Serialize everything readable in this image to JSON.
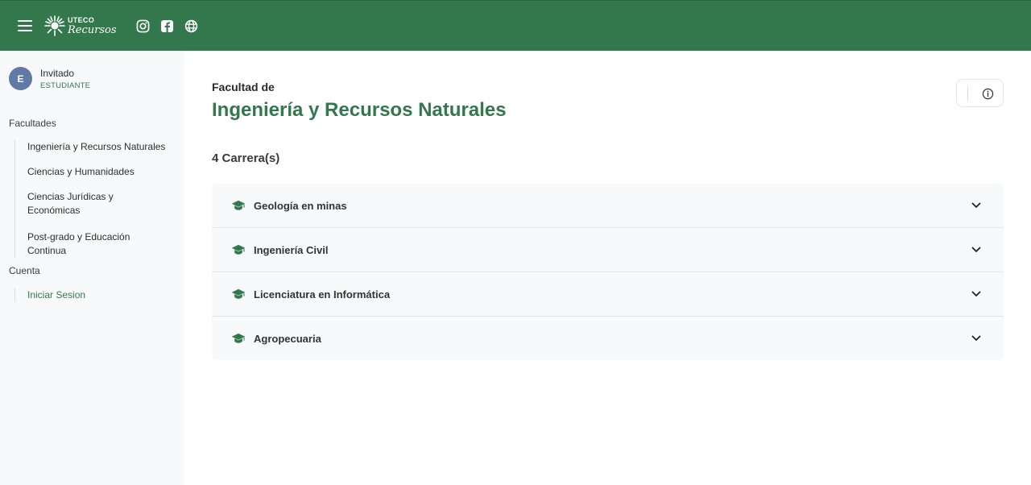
{
  "app": {
    "logo_top": "UTECO",
    "logo_bottom": "Recursos",
    "social_icons": [
      "instagram-icon",
      "facebook-icon",
      "globe-icon"
    ],
    "brand_color": "#33784c"
  },
  "user": {
    "initial": "E",
    "name": "Invitado",
    "role": "ESTUDIANTE"
  },
  "sidebar": {
    "faculties_title": "Facultades",
    "faculties": [
      "Ingeniería y Recursos Naturales",
      "Ciencias y Humanidades",
      "Ciencias Jurídicas y Económicas",
      "Post-grado y Educación Continua"
    ],
    "account_title": "Cuenta",
    "account_items": [
      "Iniciar Sesion"
    ]
  },
  "main": {
    "subtitle": "Facultad de",
    "title": "Ingeniería y Recursos Naturales",
    "count": "4 Carrera(s)",
    "careers": [
      "Geología en minas",
      "Ingeniería Civil",
      "Licenciatura en Informática",
      "Agropecuaria"
    ]
  }
}
